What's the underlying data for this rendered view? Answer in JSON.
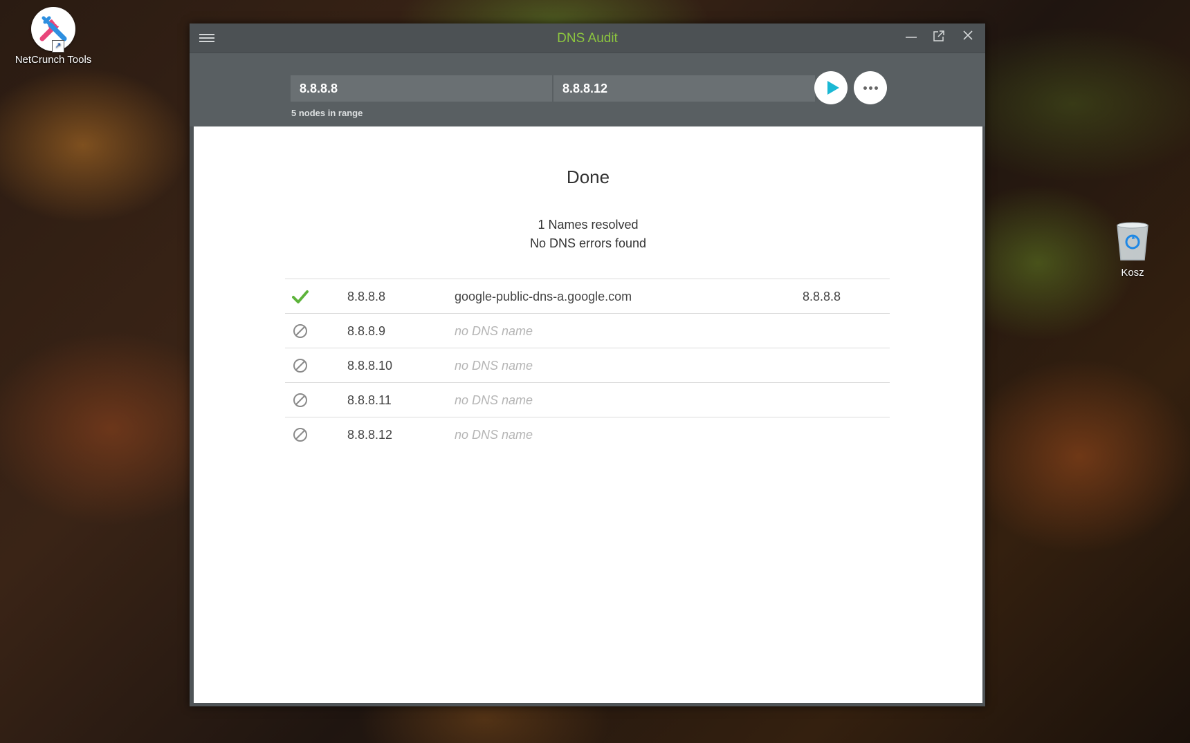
{
  "desktop": {
    "icons": [
      {
        "label": "NetCrunch Tools"
      },
      {
        "label": "Kosz"
      }
    ]
  },
  "window": {
    "title": "DNS Audit",
    "title_color": "#8dc63f"
  },
  "toolbar": {
    "range_from": "8.8.8.8",
    "range_to": "8.8.8.12",
    "range_note": "5 nodes in range",
    "accent_color": "#1ab8d4"
  },
  "main": {
    "status": "Done",
    "summary_line1": "1 Names resolved",
    "summary_line2": "No DNS errors found",
    "results": [
      {
        "status_icon": "check-icon",
        "ip": "8.8.8.8",
        "dns": "google-public-dns-a.google.com",
        "reverse": "8.8.8.8"
      },
      {
        "status_icon": "no-entry-icon",
        "ip": "8.8.8.9",
        "dns": "no DNS name",
        "reverse": ""
      },
      {
        "status_icon": "no-entry-icon",
        "ip": "8.8.8.10",
        "dns": "no DNS name",
        "reverse": ""
      },
      {
        "status_icon": "no-entry-icon",
        "ip": "8.8.8.11",
        "dns": "no DNS name",
        "reverse": ""
      },
      {
        "status_icon": "no-entry-icon",
        "ip": "8.8.8.12",
        "dns": "no DNS name",
        "reverse": ""
      }
    ]
  }
}
